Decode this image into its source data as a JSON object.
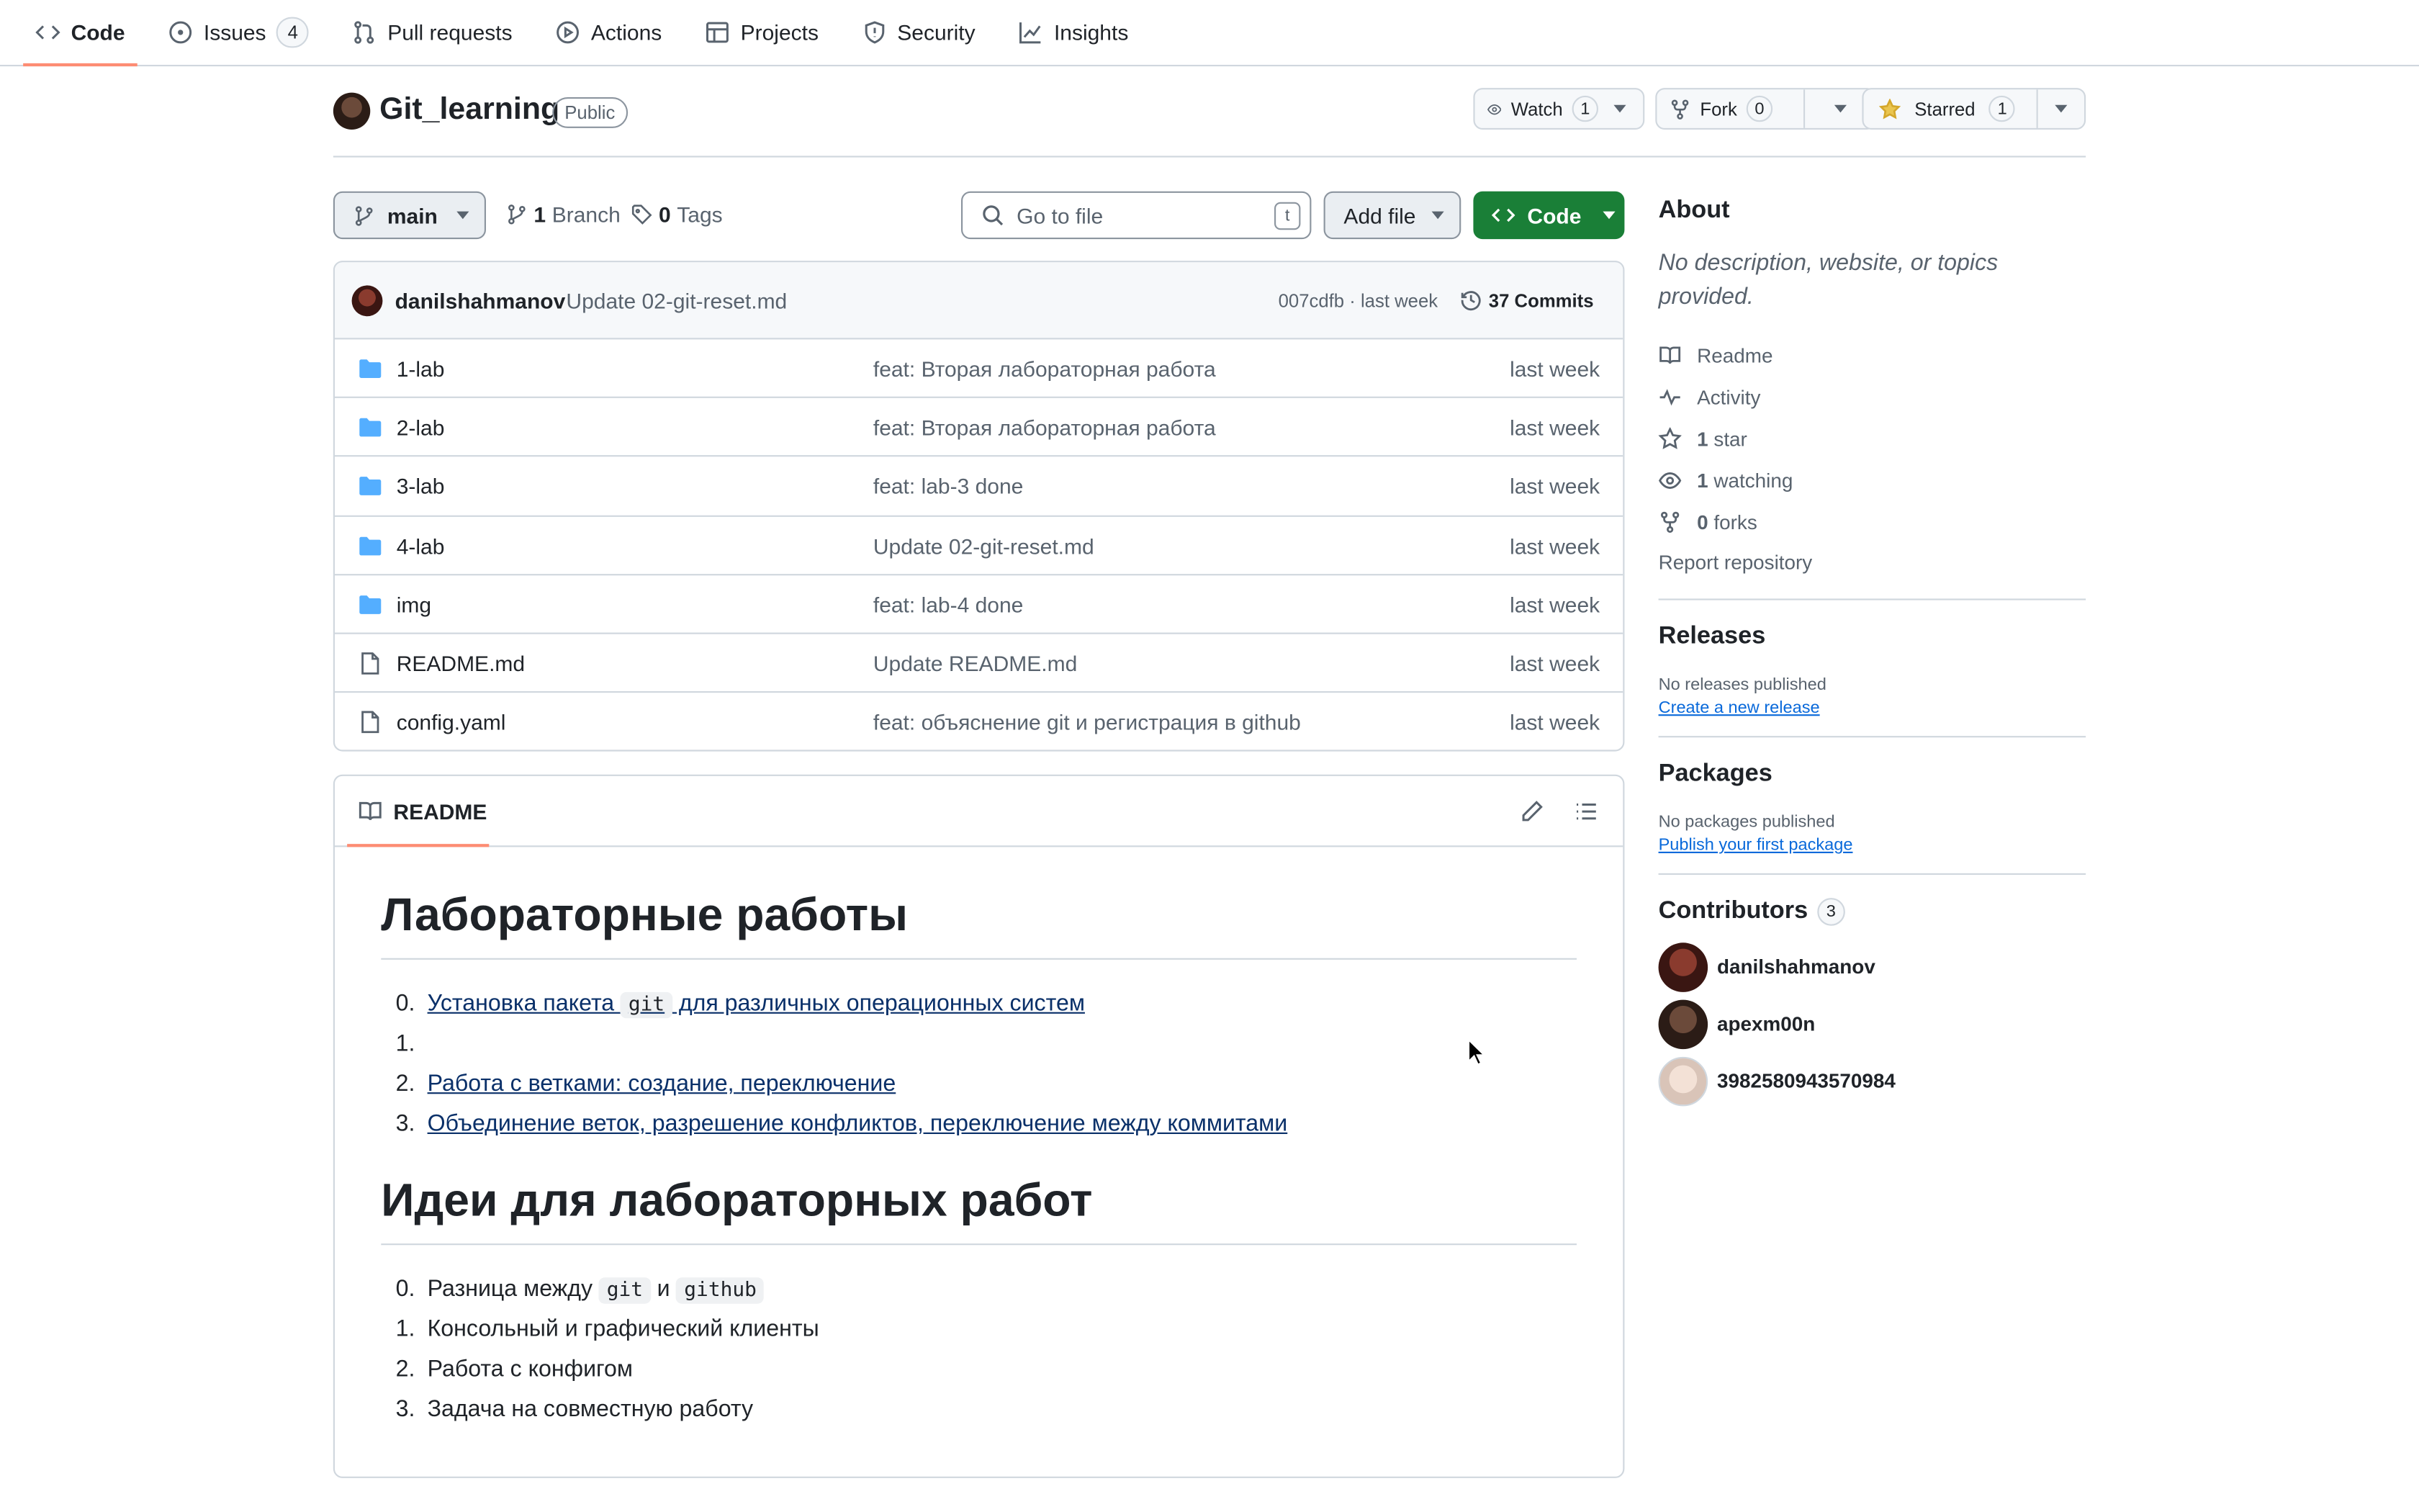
{
  "nav": {
    "tabs": [
      {
        "label": "Code",
        "icon": "code-icon",
        "active": true
      },
      {
        "label": "Issues",
        "icon": "issue-icon",
        "count": "4"
      },
      {
        "label": "Pull requests",
        "icon": "pull-request-icon"
      },
      {
        "label": "Actions",
        "icon": "play-icon"
      },
      {
        "label": "Projects",
        "icon": "table-icon"
      },
      {
        "label": "Security",
        "icon": "shield-icon"
      },
      {
        "label": "Insights",
        "icon": "graph-icon"
      }
    ]
  },
  "repo": {
    "name": "Git_learning",
    "visibility": "Public",
    "watch": {
      "label": "Watch",
      "count": "1"
    },
    "fork": {
      "label": "Fork",
      "count": "0"
    },
    "star": {
      "label": "Starred",
      "count": "1"
    }
  },
  "toolbar": {
    "branch": "main",
    "branches_count": "1",
    "branches_label": "Branch",
    "tags_count": "0",
    "tags_label": "Tags",
    "search_placeholder": "Go to file",
    "search_shortcut": "t",
    "add_file": "Add file",
    "code": "Code"
  },
  "commit": {
    "author": "danilshahmanov",
    "message": "Update 02-git-reset.md",
    "meta": "007cdfb · last week",
    "count_label": "37 Commits"
  },
  "files": [
    {
      "type": "folder",
      "name": "1-lab",
      "message": "feat: Вторая лабораторная работа",
      "date": "last week"
    },
    {
      "type": "folder",
      "name": "2-lab",
      "message": "feat: Вторая лабораторная работа",
      "date": "last week"
    },
    {
      "type": "folder",
      "name": "3-lab",
      "message": "feat: lab-3 done",
      "date": "last week"
    },
    {
      "type": "folder",
      "name": "4-lab",
      "message": "Update 02-git-reset.md",
      "date": "last week"
    },
    {
      "type": "folder",
      "name": "img",
      "message": "feat: lab-4 done",
      "date": "last week"
    },
    {
      "type": "file",
      "name": "README.md",
      "message": "Update README.md",
      "date": "last week"
    },
    {
      "type": "file",
      "name": "config.yaml",
      "message": "feat: объяснение git и регистрация в github",
      "date": "last week"
    }
  ],
  "readme": {
    "tab_label": "README",
    "h1": "Лабораторные работы",
    "labs": [
      {
        "num": "0.",
        "before": "Установка пакета ",
        "code": "git",
        "after": " для различных операционных систем"
      },
      {
        "num": "1.",
        "text": ""
      },
      {
        "num": "2.",
        "text": "Работа с ветками: создание, переключение"
      },
      {
        "num": "3.",
        "text": "Объединение веток, разрешение конфликтов, переключение между коммитами"
      }
    ],
    "h2": "Идеи для лабораторных работ",
    "ideas": [
      {
        "num": "0.",
        "before": "Разница между ",
        "code1": "git",
        "middle": " и ",
        "code2": "github"
      },
      {
        "num": "1.",
        "text": "Консольный и графический клиенты"
      },
      {
        "num": "2.",
        "text": "Работа с конфигом"
      },
      {
        "num": "3.",
        "text": "Задача на совместную работу"
      }
    ]
  },
  "about": {
    "title": "About",
    "description": "No description, website, or topics provided.",
    "links": [
      {
        "icon": "book-icon",
        "bold": "",
        "text": "Readme"
      },
      {
        "icon": "pulse-icon",
        "bold": "",
        "text": "Activity"
      },
      {
        "icon": "star-icon",
        "bold": "1",
        "text": " star"
      },
      {
        "icon": "eye-icon",
        "bold": "1",
        "text": " watching"
      },
      {
        "icon": "fork-icon",
        "bold": "0",
        "text": " forks"
      }
    ],
    "report": "Report repository"
  },
  "releases": {
    "title": "Releases",
    "note": "No releases published",
    "link": "Create a new release"
  },
  "packages": {
    "title": "Packages",
    "note": "No packages published",
    "link": "Publish your first package"
  },
  "contributors": {
    "title": "Contributors",
    "count": "3",
    "people": [
      "danilshahmanov",
      "apexm00n",
      "3982580943570984"
    ]
  },
  "colors": {
    "accent_green": "#1a7f37",
    "link_blue": "#0969da",
    "tab_underline": "#fd8c73",
    "folder_blue": "#54aeff",
    "star_yellow": "#eac54f"
  }
}
